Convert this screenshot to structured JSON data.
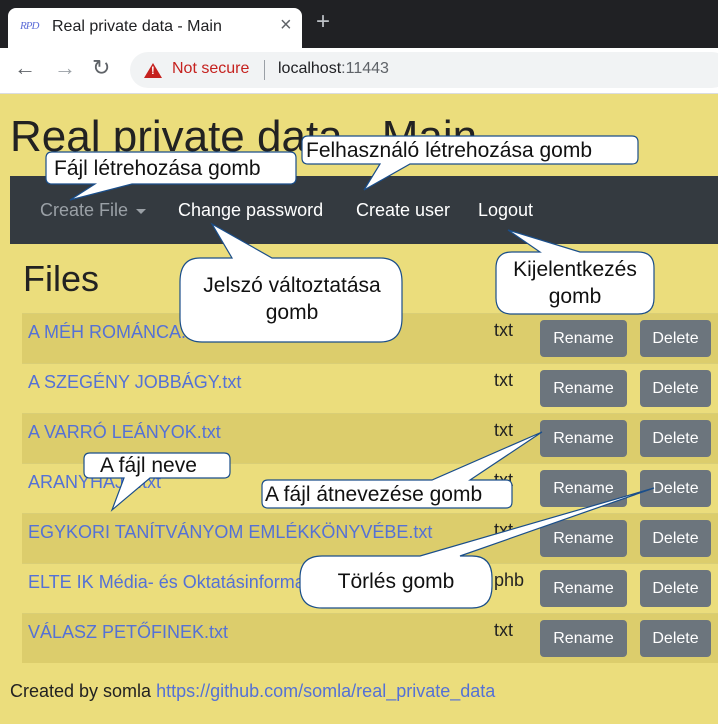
{
  "browser": {
    "tab_title": "Real private data - Main",
    "favicon_text": "RPD",
    "close_glyph": "×",
    "new_tab_glyph": "+",
    "security_label": "Not secure",
    "url_host": "localhost",
    "url_port": ":11443",
    "back_glyph": "←",
    "forward_glyph": "→",
    "reload_glyph": "↻"
  },
  "page": {
    "title": "Real private data - Main",
    "files_heading": "Files"
  },
  "navbar": {
    "create_file": "Create File",
    "change_password": "Change password",
    "create_user": "Create user",
    "logout": "Logout"
  },
  "files": [
    {
      "name": "A MÉH ROMÁNCA.txt",
      "type": "txt"
    },
    {
      "name": "A SZEGÉNY JOBBÁGY.txt",
      "type": "txt"
    },
    {
      "name": "A VARRÓ LEÁNYOK.txt",
      "type": "txt"
    },
    {
      "name": "ARANYHAJÚ.txt",
      "type": "txt"
    },
    {
      "name": "EGYKORI TANÍTVÁNYOM EMLÉKKÖNYVÉBE.txt",
      "type": "txt"
    },
    {
      "name": "ELTE IK Média- és Oktatásinformatika.phb",
      "type": "phb"
    },
    {
      "name": "VÁLASZ PETŐFINEK.txt",
      "type": "txt"
    }
  ],
  "actions": {
    "rename": "Rename",
    "delete": "Delete"
  },
  "footer": {
    "prefix": "Created by somla",
    "link": "https://github.com/somla/real_private_data"
  },
  "callouts": {
    "create_file": "Fájl létrehozása gomb",
    "create_user": "Felhasználó létrehozása gomb",
    "change_password_line1": "Jelszó változtatása",
    "change_password_line2": "gomb",
    "logout_line1": "Kijelentkezés",
    "logout_line2": "gomb",
    "file_name": "A fájl neve",
    "rename": "A fájl átnevezése gomb",
    "delete": "Törlés gomb"
  },
  "colors": {
    "page_background": "#ebdd7c",
    "navbar": "#343a40",
    "link": "#5471d6",
    "button": "#6c757d",
    "warning": "#c5221f"
  }
}
